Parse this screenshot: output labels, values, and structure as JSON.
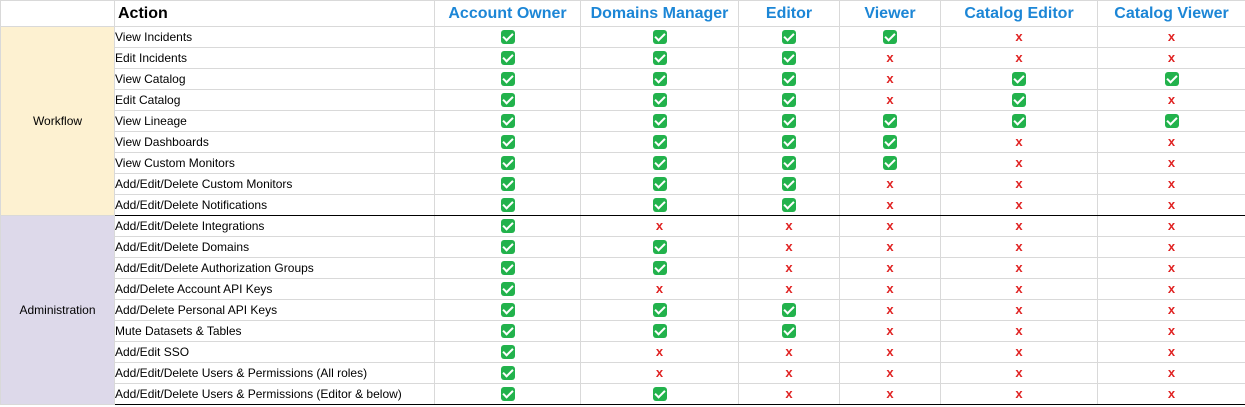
{
  "header": {
    "action": "Action",
    "roles": [
      "Account Owner",
      "Domains Manager",
      "Editor",
      "Viewer",
      "Catalog Editor",
      "Catalog Viewer"
    ]
  },
  "sections": [
    {
      "name": "Workflow",
      "rows": [
        {
          "action": "View Incidents",
          "perms": [
            true,
            true,
            true,
            true,
            false,
            false
          ]
        },
        {
          "action": "Edit Incidents",
          "perms": [
            true,
            true,
            true,
            false,
            false,
            false
          ]
        },
        {
          "action": "View Catalog",
          "perms": [
            true,
            true,
            true,
            false,
            true,
            true
          ]
        },
        {
          "action": "Edit Catalog",
          "perms": [
            true,
            true,
            true,
            false,
            true,
            false
          ]
        },
        {
          "action": "View Lineage",
          "perms": [
            true,
            true,
            true,
            true,
            true,
            true
          ]
        },
        {
          "action": "View Dashboards",
          "perms": [
            true,
            true,
            true,
            true,
            false,
            false
          ]
        },
        {
          "action": "View Custom Monitors",
          "perms": [
            true,
            true,
            true,
            true,
            false,
            false
          ]
        },
        {
          "action": "Add/Edit/Delete Custom Monitors",
          "perms": [
            true,
            true,
            true,
            false,
            false,
            false
          ]
        },
        {
          "action": "Add/Edit/Delete Notifications",
          "perms": [
            true,
            true,
            true,
            false,
            false,
            false
          ]
        }
      ]
    },
    {
      "name": "Administration",
      "rows": [
        {
          "action": "Add/Edit/Delete Integrations",
          "perms": [
            true,
            false,
            false,
            false,
            false,
            false
          ]
        },
        {
          "action": "Add/Edit/Delete Domains",
          "perms": [
            true,
            true,
            false,
            false,
            false,
            false
          ]
        },
        {
          "action": "Add/Edit/Delete Authorization Groups",
          "perms": [
            true,
            true,
            false,
            false,
            false,
            false
          ]
        },
        {
          "action": "Add/Delete Account API Keys",
          "perms": [
            true,
            false,
            false,
            false,
            false,
            false
          ]
        },
        {
          "action": "Add/Delete Personal API Keys",
          "perms": [
            true,
            true,
            true,
            false,
            false,
            false
          ]
        },
        {
          "action": "Mute Datasets & Tables",
          "perms": [
            true,
            true,
            true,
            false,
            false,
            false
          ]
        },
        {
          "action": "Add/Edit SSO",
          "perms": [
            true,
            false,
            false,
            false,
            false,
            false
          ]
        },
        {
          "action": "Add/Edit/Delete Users & Permissions (All roles)",
          "perms": [
            true,
            false,
            false,
            false,
            false,
            false
          ]
        },
        {
          "action": "Add/Edit/Delete Users & Permissions (Editor & below)",
          "perms": [
            true,
            true,
            false,
            false,
            false,
            false
          ]
        }
      ]
    }
  ],
  "symbols": {
    "allowed": "check-icon",
    "denied": "x"
  },
  "colors": {
    "role_header": "#1c86d6",
    "workflow_bg": "#fdf1d1",
    "administration_bg": "#ddd9ea",
    "check": "#22b24c",
    "cross": "#e02323"
  }
}
